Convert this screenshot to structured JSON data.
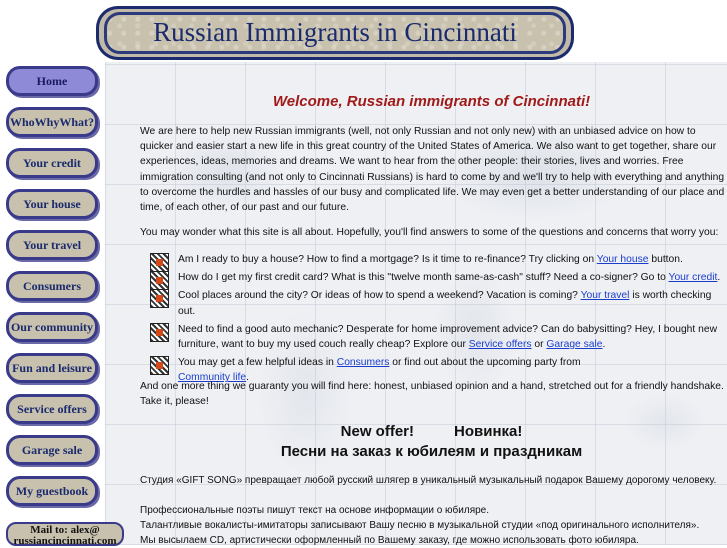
{
  "banner": {
    "title": "Russian Immigrants in Cincinnati"
  },
  "nav": [
    {
      "label": "Home",
      "active": true
    },
    {
      "label": "WhoWhyWhat?"
    },
    {
      "label": "Your credit"
    },
    {
      "label": "Your house"
    },
    {
      "label": "Your travel"
    },
    {
      "label": "Consumers"
    },
    {
      "label": "Our community"
    },
    {
      "label": "Fun and leisure"
    },
    {
      "label": "Service offers"
    },
    {
      "label": "Garage sale"
    },
    {
      "label": "My guestbook"
    }
  ],
  "mailto": {
    "line1": "Mail to:  alex@",
    "line2": "russiancincinnati.com"
  },
  "main": {
    "welcome": "Welcome, Russian immigrants of Cincinnati!",
    "intro": "We are here to help new Russian immigrants (well, not only Russian and not only new) with an unbiased advice on how to quicker and easier start a new life in this great country of the United States of America.  We also want to get together, share our experiences, ideas, memories and dreams. We want to hear from the other people: their stories, lives and worries. Free immigration consulting (and not only to Cincinnati Russians) is hard to come by and we'll try to help with everything and anything  to overcome the hurdles and hassles of our busy and complicated life. We may even get a better understanding of our place and time, of each other, of our past and our future.",
    "wonder": "You may wonder what this site is all about. Hopefully, you'll find answers to some of the questions and concerns that worry you:",
    "bullets": [
      {
        "pre": "Am I ready to buy a house? How to find a mortgage? Is it time to re-finance? Try clicking on ",
        "link": "Your house",
        "post": " button."
      },
      {
        "pre": "How do I get my first credit card? What is this \"twelve month same-as-cash\" stuff? Need a co-signer? Go to ",
        "link": "Your credit",
        "post": "."
      },
      {
        "pre": "Cool places around the city? Or ideas of how to spend a weekend? Vacation is coming?  ",
        "link": "Your travel",
        "post": " is worth checking out."
      },
      {
        "pre": "Need to find a good auto mechanic? Desperate for home improvement advice? Can do babysitting? Hey, I bought new furniture, want to buy my used couch really cheap? Explore our ",
        "link": "Service offers",
        "mid": " or ",
        "link2": "Garage sale",
        "post": "."
      },
      {
        "pre": "You may get a few helpful ideas in ",
        "link": "Consumers",
        "mid": " or find out about the upcoming party from ",
        "link2": "Community life",
        "post": "."
      }
    ],
    "guaranty": "And one more thing we guaranty you will find here: honest, unbiased opinion and a hand, stretched out for a friendly handshake. Take it, please!",
    "offer_en": "New offer!",
    "offer_ru": "Новинка!",
    "offer_sub": "Песни на заказ к юбилеям и праздникам",
    "ru_lines": [
      "Студия «GIFT SONG» превращает любой русский шлягер в уникальный музыкальный подарок Вашему дорогому человеку.",
      "Профессиональные поэты пишут текст на основе информации о юбиляре.",
      "Талантливые вокалисты-имитаторы записывают Вашу песню в музыкальной студии «под оригинального исполнителя».",
      "Мы высылаем CD, артистически оформленный по Вашему заказу, где можно использовать фото юбиляра."
    ]
  }
}
